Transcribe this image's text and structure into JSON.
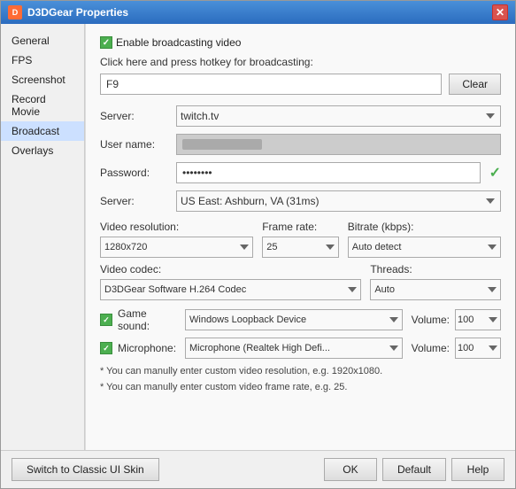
{
  "window": {
    "title": "D3DGear Properties",
    "close_label": "✕"
  },
  "sidebar": {
    "items": [
      {
        "id": "general",
        "label": "General"
      },
      {
        "id": "fps",
        "label": "FPS"
      },
      {
        "id": "screenshot",
        "label": "Screenshot"
      },
      {
        "id": "record-movie",
        "label": "Record Movie"
      },
      {
        "id": "broadcast",
        "label": "Broadcast"
      },
      {
        "id": "overlays",
        "label": "Overlays"
      }
    ],
    "active": "broadcast"
  },
  "main": {
    "enable_label": "Enable broadcasting video",
    "hotkey_section_label": "Click here and press hotkey for broadcasting:",
    "hotkey_value": "F9",
    "clear_label": "Clear",
    "server_label": "Server:",
    "server_value": "twitch.tv",
    "username_label": "User name:",
    "password_label": "Password:",
    "password_value": "••••••••",
    "server2_label": "Server:",
    "server2_value": "US East: Ashburn, VA   (31ms)",
    "video_resolution_label": "Video resolution:",
    "video_resolution_value": "1280x720",
    "frame_rate_label": "Frame rate:",
    "frame_rate_value": "25",
    "bitrate_label": "Bitrate (kbps):",
    "bitrate_value": "Auto detect",
    "video_codec_label": "Video codec:",
    "video_codec_value": "D3DGear Software H.264 Codec",
    "threads_label": "Threads:",
    "threads_value": "Auto",
    "game_sound_label": "Game sound:",
    "game_sound_device": "Windows Loopback Device",
    "game_sound_volume_label": "Volume:",
    "game_sound_volume": "100",
    "microphone_label": "Microphone:",
    "microphone_device": "Microphone (Realtek High Defi...",
    "microphone_volume_label": "Volume:",
    "microphone_volume": "100",
    "hint1": "* You can manully enter custom video resolution, e.g. 1920x1080.",
    "hint2": "* You can manully enter custom video frame rate, e.g. 25."
  },
  "footer": {
    "classic_skin_label": "Switch to Classic UI Skin",
    "ok_label": "OK",
    "default_label": "Default",
    "help_label": "Help"
  }
}
